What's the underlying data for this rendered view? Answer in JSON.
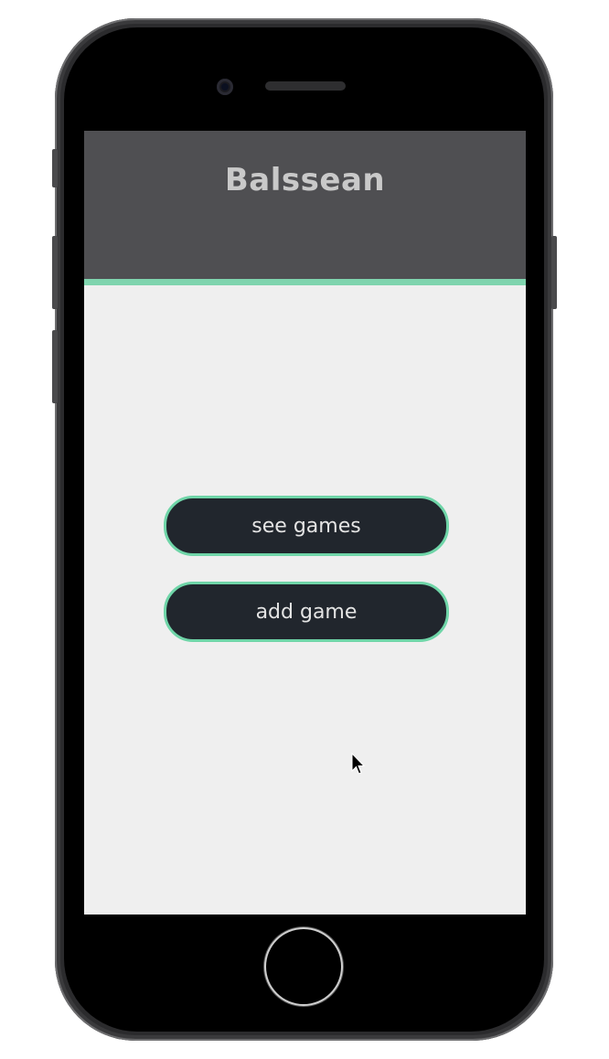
{
  "app": {
    "title": "Balssean"
  },
  "menu": {
    "see_games_label": "see games",
    "add_game_label": "add game"
  },
  "colors": {
    "header_bg": "#4f4f52",
    "accent": "#7fd4ae",
    "button_bg": "#21262d",
    "screen_bg": "#efefef"
  },
  "icons": {
    "cursor": "mouse-pointer-icon",
    "home": "home-button"
  }
}
